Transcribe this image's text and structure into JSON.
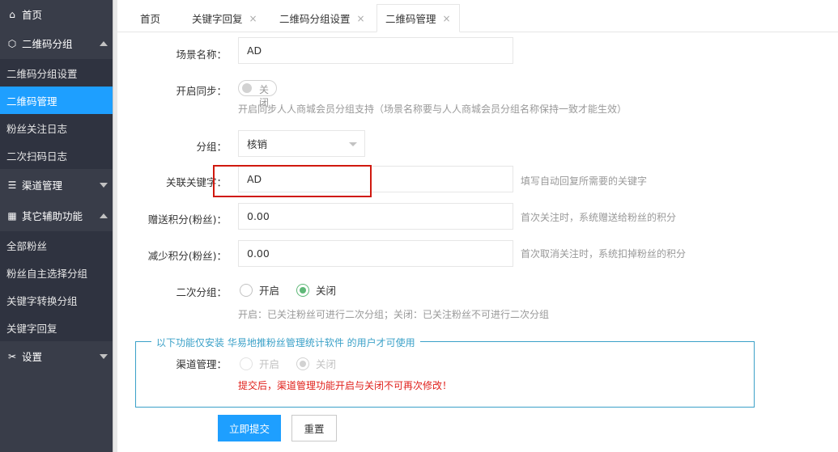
{
  "sidebar": {
    "home": "首页",
    "group_qrcode": {
      "label": "二维码分组",
      "items": [
        "二维码分组设置",
        "二维码管理",
        "粉丝关注日志",
        "二次扫码日志"
      ]
    },
    "channel": {
      "label": "渠道管理"
    },
    "aux": {
      "label": "其它辅助功能",
      "items": [
        "全部粉丝",
        "粉丝自主选择分组",
        "关键字转换分组",
        "关键字回复"
      ]
    },
    "settings": {
      "label": "设置"
    }
  },
  "tabs": [
    {
      "label": "首页"
    },
    {
      "label": "关键字回复",
      "close": "×"
    },
    {
      "label": "二维码分组设置",
      "close": "×"
    },
    {
      "label": "二维码管理",
      "close": "×"
    }
  ],
  "form": {
    "scene_name": {
      "label": "场景名称：",
      "value": "AD"
    },
    "sync": {
      "label": "开启同步：",
      "switch_text_top": "关",
      "switch_text_bottom": "闭",
      "hint": "开启同步人人商城会员分组支持（场景名称要与人人商城会员分组名称保持一致才能生效）"
    },
    "group": {
      "label": "分组：",
      "value": "核销"
    },
    "keyword": {
      "label": "关联关键字：",
      "value": "AD",
      "hint": "填写自动回复所需要的关键字"
    },
    "give_points": {
      "label": "赠送积分(粉丝)：",
      "value": "0.00",
      "hint": "首次关注时，系统赠送给粉丝的积分"
    },
    "reduce_points": {
      "label": "减少积分(粉丝)：",
      "value": "0.00",
      "hint": "首次取消关注时，系统扣掉粉丝的积分"
    },
    "second_group": {
      "label": "二次分组：",
      "on": "开启",
      "off": "关闭",
      "hint": "开启：已关注粉丝可进行二次分组；关闭：已关注粉丝不可进行二次分组"
    },
    "fieldset": {
      "legend": "以下功能仅安装 华易地推粉丝管理统计软件 的用户才可使用",
      "channel_label": "渠道管理：",
      "on": "开启",
      "off": "关闭",
      "warning": "提交后，渠道管理功能开启与关闭不可再次修改！"
    },
    "submit": "立即提交",
    "reset": "重置"
  },
  "colors": {
    "sidebar_bg": "#393d49",
    "active_blue": "#1e9fff",
    "radio_green": "#5fb878",
    "highlight_red": "#d0190f",
    "fieldset_border": "#3ba1c8"
  }
}
